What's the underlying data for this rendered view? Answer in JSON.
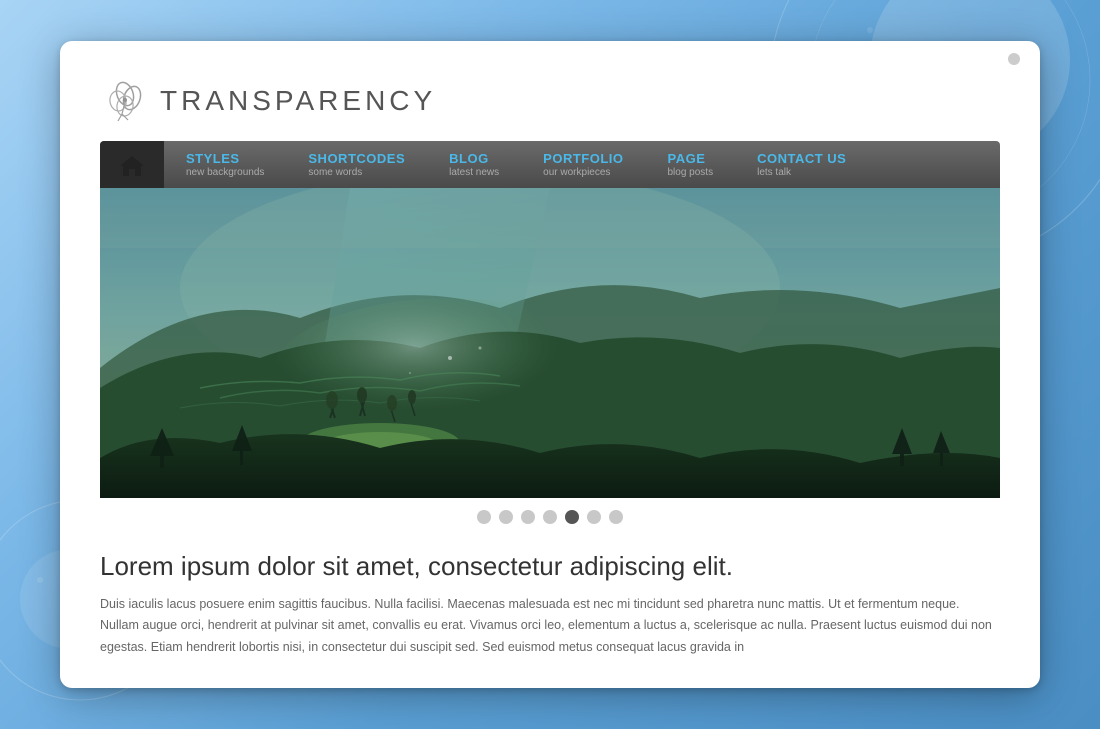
{
  "background": {
    "color_start": "#a8d4f5",
    "color_end": "#4a8ec4"
  },
  "browser": {
    "dot_color": "#cccccc"
  },
  "header": {
    "logo_text": "TRANSPARENCY"
  },
  "navbar": {
    "home_label": "Home",
    "items": [
      {
        "label": "STYLES",
        "sublabel": "new backgrounds"
      },
      {
        "label": "SHORTCODES",
        "sublabel": "some words"
      },
      {
        "label": "BLOG",
        "sublabel": "latest news"
      },
      {
        "label": "PORTFOLIO",
        "sublabel": "our workpieces"
      },
      {
        "label": "PAGE",
        "sublabel": "blog posts"
      },
      {
        "label": "CONTACT US",
        "sublabel": "lets talk"
      }
    ]
  },
  "slider": {
    "dots": [
      {
        "id": 1,
        "active": false
      },
      {
        "id": 2,
        "active": false
      },
      {
        "id": 3,
        "active": false
      },
      {
        "id": 4,
        "active": false
      },
      {
        "id": 5,
        "active": true
      },
      {
        "id": 6,
        "active": false
      },
      {
        "id": 7,
        "active": false
      }
    ]
  },
  "content": {
    "title": "Lorem ipsum dolor sit amet, consectetur adipiscing elit.",
    "body": "Duis iaculis lacus posuere enim sagittis faucibus. Nulla facilisi. Maecenas malesuada est nec mi tincidunt sed pharetra nunc mattis. Ut et fermentum neque. Nullam augue orci, hendrerit at pulvinar sit amet, convallis eu erat. Vivamus orci leo, elementum a luctus a, scelerisque ac nulla. Praesent luctus euismod dui non egestas. Etiam hendrerit lobortis nisi, in consectetur dui suscipit sed. Sed euismod metus consequat lacus gravida in"
  }
}
